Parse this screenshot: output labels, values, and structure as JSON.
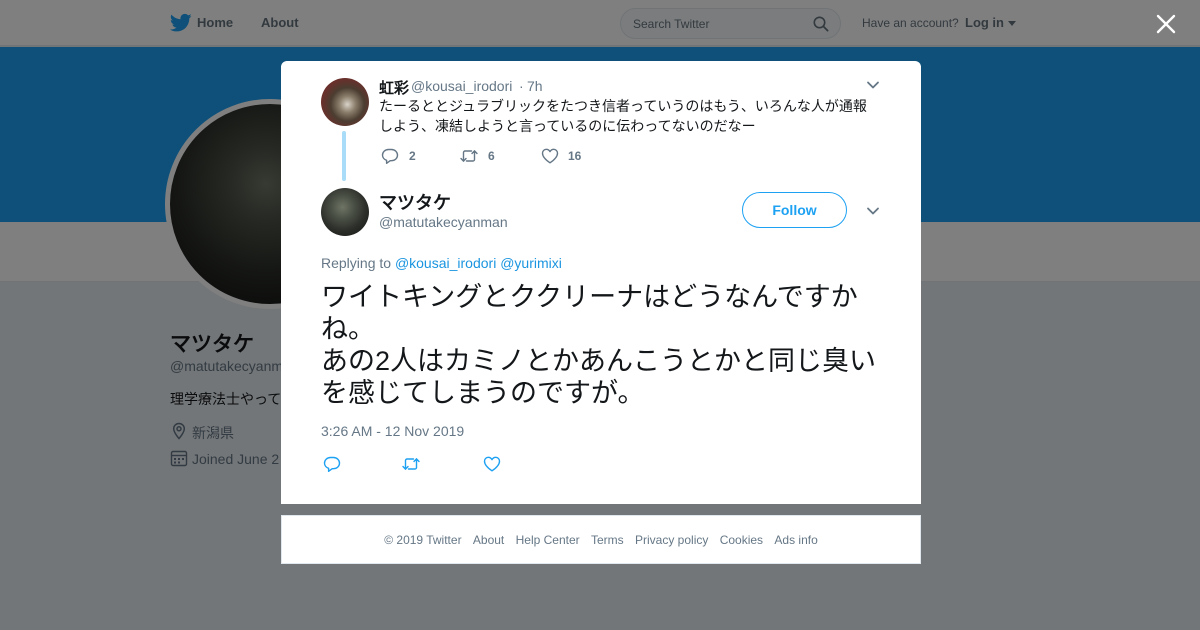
{
  "nav": {
    "home_label": "Home",
    "about_label": "About",
    "search_placeholder": "Search Twitter",
    "account_prompt": "Have an account?",
    "login_label": "Log in"
  },
  "profile": {
    "name": "マツタケ",
    "handle": "@matutakecyanm",
    "bio": "理学療法士やって",
    "location": "新潟県",
    "joined": "Joined June 2"
  },
  "ancestor_tweet": {
    "name": "虹彩",
    "handle": "@kousai_irodori",
    "separator": "·",
    "time": "7h",
    "text": "たーるととジュラブリックをたつき信者っていうのはもう、いろんな人が通報しよう、凍結しようと言っているのに伝わってないのだなー",
    "reply_count": "2",
    "retweet_count": "6",
    "like_count": "16"
  },
  "main_tweet": {
    "name": "マツタケ",
    "handle": "@matutakecyanman",
    "follow_label": "Follow",
    "replying_prefix": "Replying to",
    "mentions": [
      "@kousai_irodori",
      "@yurimixi"
    ],
    "text": "ワイトキングとククリーナはどうなんですかね。\nあの2人はカミノとかあんこうとかと同じ臭いを感じてしまうのですが。",
    "timestamp": "3:26 AM - 12 Nov 2019"
  },
  "footer": {
    "links": [
      "© 2019 Twitter",
      "About",
      "Help Center",
      "Terms",
      "Privacy policy",
      "Cookies",
      "Ads info"
    ]
  },
  "colors": {
    "accent": "#1da1f2",
    "link": "#1b95e0",
    "secondary_text": "#657786",
    "thread_line": "#a9dcf9",
    "background": "#e6ecf0"
  },
  "icons": [
    "twitter-bird-icon",
    "search-icon",
    "close-icon",
    "reply-icon",
    "retweet-icon",
    "like-icon",
    "chevron-down-icon",
    "location-icon",
    "calendar-icon"
  ]
}
